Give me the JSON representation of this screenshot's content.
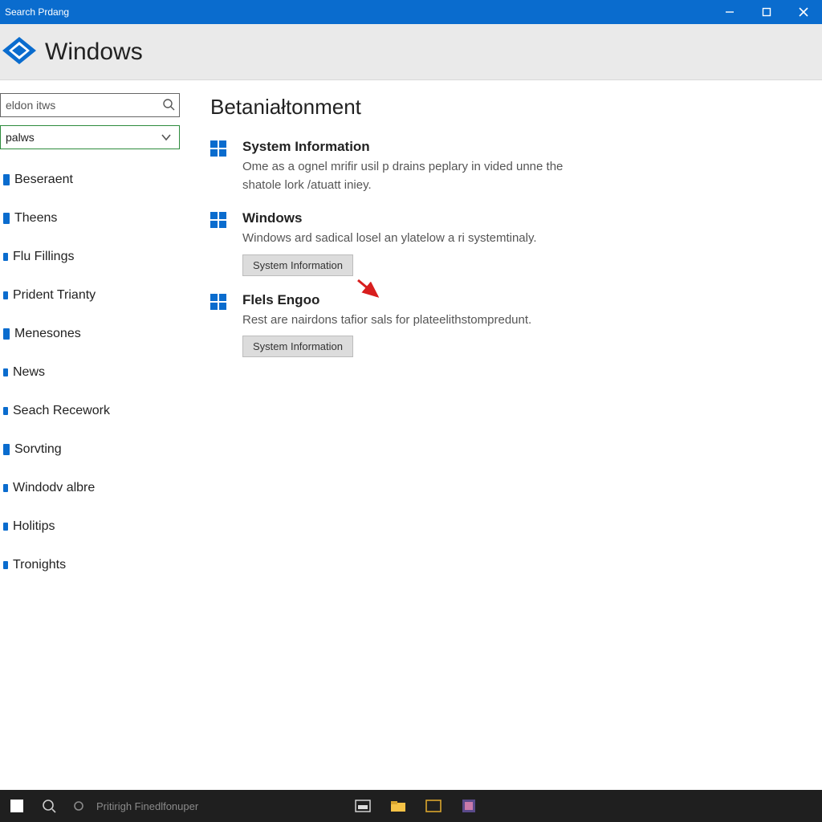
{
  "titlebar": {
    "title": "Search Prdang"
  },
  "header": {
    "brand": "Windows"
  },
  "sidebar": {
    "search": {
      "value": "eldon itws"
    },
    "filter": {
      "value": "palws"
    },
    "items": [
      {
        "label": "Beseraent"
      },
      {
        "label": "Theens"
      },
      {
        "label": "Flu Fillings"
      },
      {
        "label": "Prident Trianty"
      },
      {
        "label": "Menesones"
      },
      {
        "label": "News"
      },
      {
        "label": "Seach Recework"
      },
      {
        "label": "Sorvting"
      },
      {
        "label": "Windodv albre"
      },
      {
        "label": "Holitips"
      },
      {
        "label": "Tronights"
      }
    ]
  },
  "content": {
    "page_title": "Betaniałtonment",
    "sections": [
      {
        "title": "System Information",
        "desc": "Ome as a ognel mrifir usil p drains peplary in vided unne the shatole lork /atuatt iniey.",
        "button": null
      },
      {
        "title": "Windows",
        "desc": "Windows ard sadical losel an ylatelow a ri systemtinaly.",
        "button": "System Information"
      },
      {
        "title": "Flels Engoo",
        "desc": "Rest are nairdons tafior sals for plateelithstompredunt.",
        "button": "System Information"
      }
    ]
  },
  "taskbar": {
    "search_hint": "Pritirigh Finedlfonuper"
  }
}
